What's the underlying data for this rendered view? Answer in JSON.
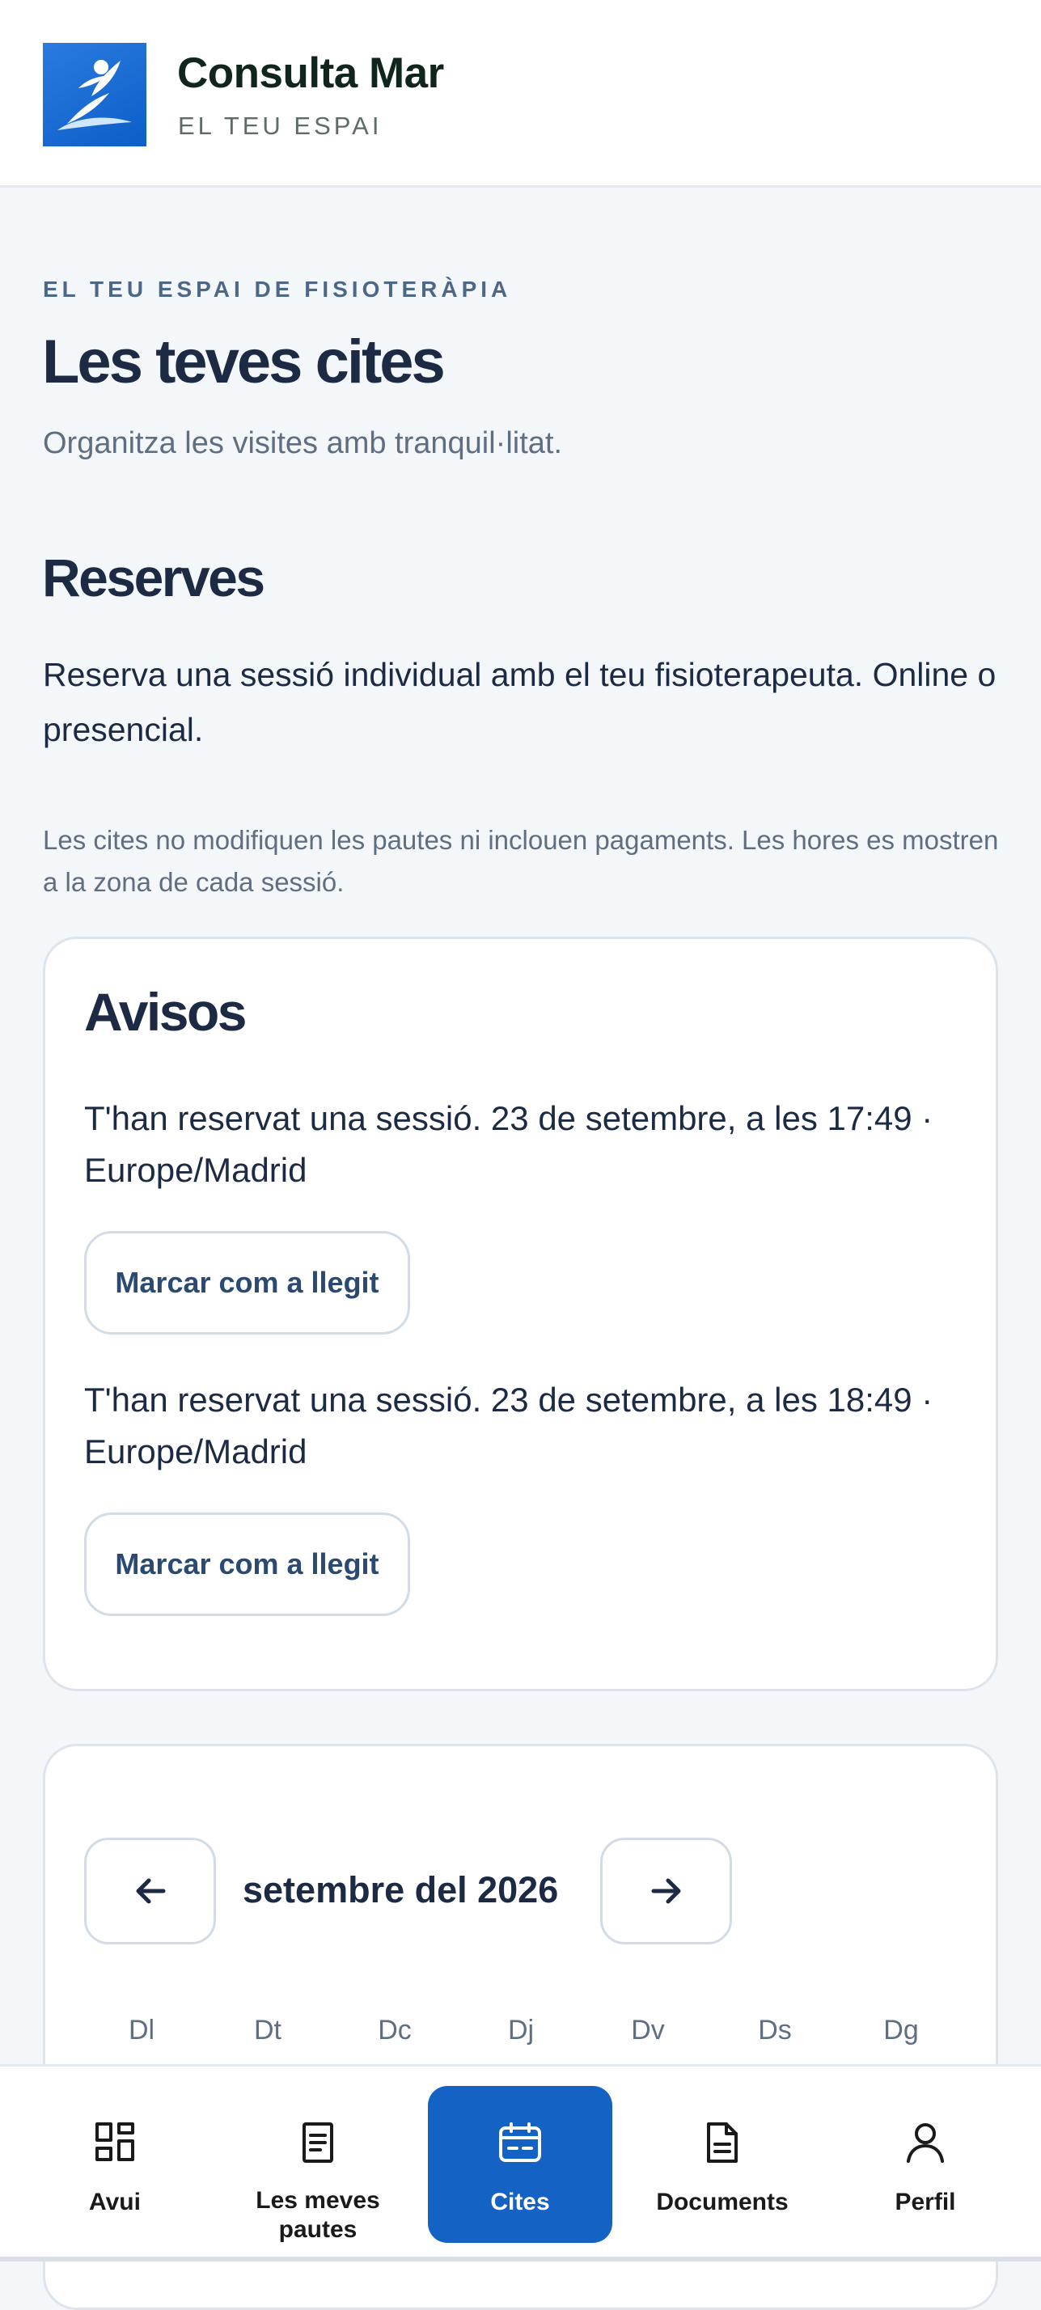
{
  "brand": {
    "name": "Consulta Mar",
    "tagline": "EL TEU ESPAI"
  },
  "hero": {
    "eyebrow": "EL TEU ESPAI DE FISIOTERÀPIA",
    "title": "Les teves cites",
    "subtitle": "Organitza les visites amb tranquil·litat."
  },
  "reserves": {
    "title": "Reserves",
    "description": "Reserva una sessió individual amb el teu fisioterapeuta. Online o presencial.",
    "note": "Les cites no modifiquen les pautes ni inclouen pagaments. Les hores es mostren a la zona de cada sessió."
  },
  "avisos": {
    "title": "Avisos",
    "notices": [
      {
        "text": "T'han reservat una sessió. 23 de setembre, a les 17:49 · Europe/Madrid",
        "button": "Marcar com a llegit"
      },
      {
        "text": "T'han reservat una sessió. 23 de setembre, a les 18:49 · Europe/Madrid",
        "button": "Marcar com a llegit"
      }
    ]
  },
  "calendar": {
    "month": "setembre del 2026",
    "prev_icon": "arrow-left-icon",
    "next_icon": "arrow-right-icon",
    "weekdays": [
      "Dl",
      "Dt",
      "Dc",
      "Dj",
      "Dv",
      "Ds",
      "Dg"
    ]
  },
  "nav": {
    "active": "Cites",
    "items": [
      {
        "label": "Avui",
        "icon": "grid-icon"
      },
      {
        "label": "Les meves pautes",
        "icon": "clipboard-icon"
      },
      {
        "label": "Cites",
        "icon": "calendar-icon"
      },
      {
        "label": "Documents",
        "icon": "document-icon"
      },
      {
        "label": "Perfil",
        "icon": "user-icon"
      }
    ]
  },
  "colors": {
    "accent": "#1463c4",
    "heading": "#1c2b43",
    "muted": "#5f6e80",
    "background": "#f4f7fa"
  }
}
